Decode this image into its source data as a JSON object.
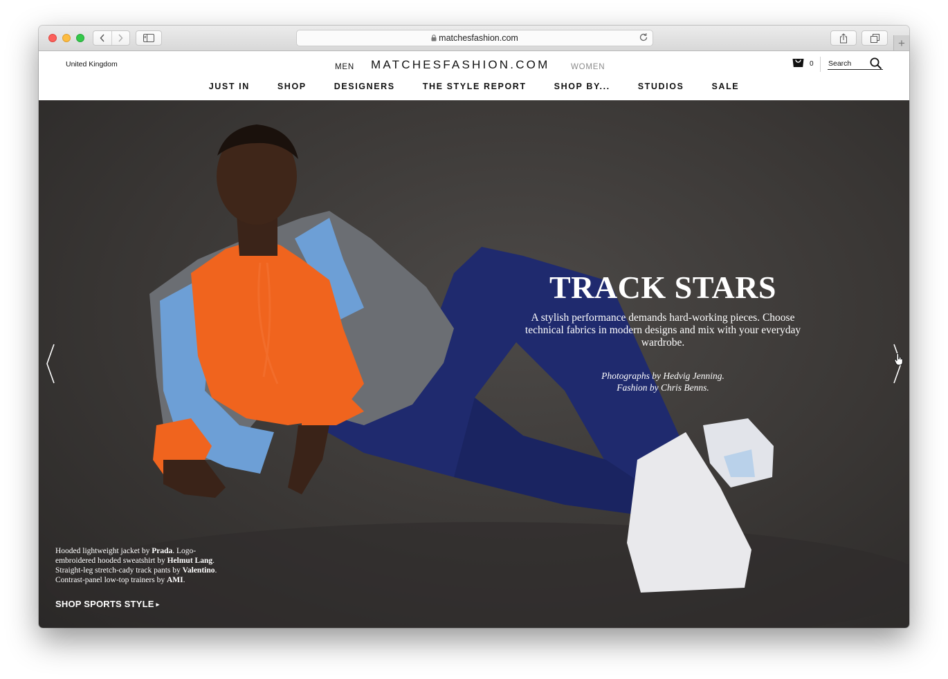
{
  "browser": {
    "url": "matchesfashion.com"
  },
  "header": {
    "region": "United Kingdom",
    "gender_men": "MEN",
    "logo": "MATCHESFASHION.COM",
    "gender_women": "WOMEN",
    "bag_count": "0",
    "search_placeholder": "Search"
  },
  "nav": {
    "items": [
      "JUST IN",
      "SHOP",
      "DESIGNERS",
      "THE STYLE REPORT",
      "SHOP BY...",
      "STUDIOS",
      "SALE"
    ]
  },
  "hero": {
    "title": "TRACK STARS",
    "text": "A stylish performance demands hard-working pieces. Choose technical fabrics in modern designs and mix with your everyday wardrobe.",
    "credit_photographer": "Photographs by Hedvig Jenning.",
    "credit_fashion": "Fashion by Chris Benns.",
    "caption": {
      "t1": "Hooded lightweight jacket by ",
      "b1": "Prada",
      "t2": ". Logo-embroidered hooded sweatshirt by ",
      "b2": "Helmut Lang",
      "t3": ". Straight-leg stretch-cady track pants by ",
      "b3": "Valentino",
      "t4": ". Contrast-panel low-top trainers by ",
      "b4": "AMI",
      "t5": "."
    },
    "cta": "SHOP SPORTS STYLE",
    "cta_caret": "▸"
  },
  "colors": {
    "hero_bg": "#3a3735",
    "hoodie": "#f0641e",
    "pants": "#1f2a6e",
    "jacket_blue": "#6d9fd6",
    "jacket_grey": "#6b6e73"
  }
}
